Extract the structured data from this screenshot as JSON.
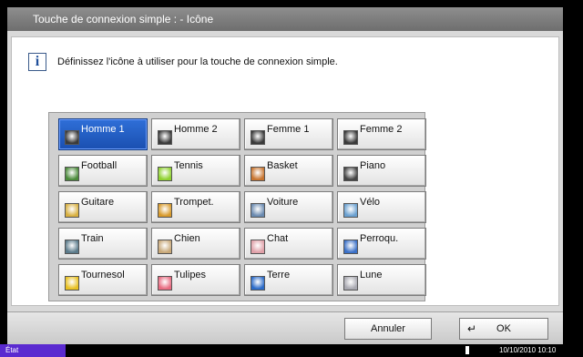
{
  "window": {
    "title": "Touche de connexion simple :   - Icône"
  },
  "message": {
    "text": "Définissez l'icône à utiliser pour la touche de connexion simple.",
    "icon": "info-icon"
  },
  "icons": [
    {
      "label": "Homme 1",
      "icon": "man-silhouette-icon",
      "selected": true,
      "color": "#3a3a3a"
    },
    {
      "label": "Homme 2",
      "icon": "man-silhouette-icon",
      "color": "#3a3a3a"
    },
    {
      "label": "Femme 1",
      "icon": "woman-silhouette-icon",
      "color": "#3a3a3a"
    },
    {
      "label": "Femme 2",
      "icon": "woman-silhouette-icon",
      "color": "#3a3a3a"
    },
    {
      "label": "Football",
      "icon": "football-icon",
      "color": "#4a8a3a"
    },
    {
      "label": "Tennis",
      "icon": "tennis-ball-icon",
      "color": "#8ed12e"
    },
    {
      "label": "Basket",
      "icon": "basketball-icon",
      "color": "#c8742e"
    },
    {
      "label": "Piano",
      "icon": "piano-icon",
      "color": "#444444"
    },
    {
      "label": "Guitare",
      "icon": "guitar-icon",
      "color": "#d8b040"
    },
    {
      "label": "Trompet.",
      "icon": "trumpet-icon",
      "color": "#d89a2a"
    },
    {
      "label": "Voiture",
      "icon": "car-icon",
      "color": "#6a8ab0"
    },
    {
      "label": "Vélo",
      "icon": "bicycle-icon",
      "color": "#6aa0d0"
    },
    {
      "label": "Train",
      "icon": "train-icon",
      "color": "#5a7a8a"
    },
    {
      "label": "Chien",
      "icon": "dog-icon",
      "color": "#c8a878"
    },
    {
      "label": "Chat",
      "icon": "cat-icon",
      "color": "#e0a0a8"
    },
    {
      "label": "Perroqu.",
      "icon": "parrot-icon",
      "color": "#3a70c8"
    },
    {
      "label": "Tournesol",
      "icon": "sunflower-icon",
      "color": "#e8c020"
    },
    {
      "label": "Tulipes",
      "icon": "tulips-icon",
      "color": "#e86a80"
    },
    {
      "label": "Terre",
      "icon": "earth-icon",
      "color": "#2a6ac8"
    },
    {
      "label": "Lune",
      "icon": "moon-icon",
      "color": "#a8a8b0"
    }
  ],
  "actions": {
    "cancel_label": "Annuler",
    "ok_label": "OK",
    "ok_icon": "enter-arrow-icon"
  },
  "status": {
    "label": "État",
    "datetime": "10/10/2010  10:10"
  },
  "colors": {
    "selected": "#1f5ccc",
    "status_badge": "#5a2ad0"
  }
}
